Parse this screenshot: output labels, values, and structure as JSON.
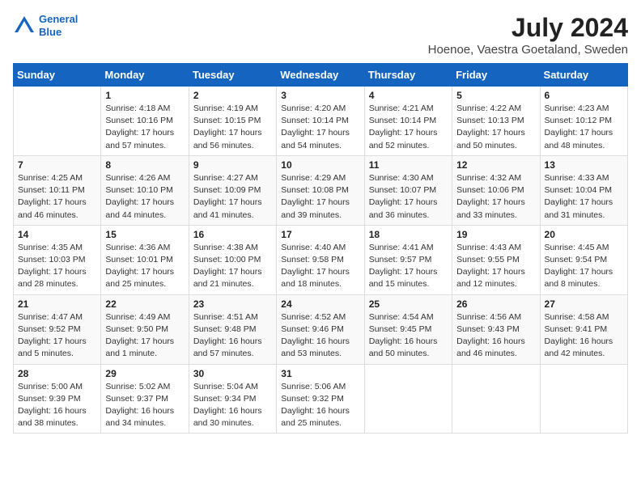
{
  "header": {
    "logo_line1": "General",
    "logo_line2": "Blue",
    "month_year": "July 2024",
    "location": "Hoenoe, Vaestra Goetaland, Sweden"
  },
  "weekdays": [
    "Sunday",
    "Monday",
    "Tuesday",
    "Wednesday",
    "Thursday",
    "Friday",
    "Saturday"
  ],
  "weeks": [
    [
      {
        "day": "",
        "info": ""
      },
      {
        "day": "1",
        "info": "Sunrise: 4:18 AM\nSunset: 10:16 PM\nDaylight: 17 hours\nand 57 minutes."
      },
      {
        "day": "2",
        "info": "Sunrise: 4:19 AM\nSunset: 10:15 PM\nDaylight: 17 hours\nand 56 minutes."
      },
      {
        "day": "3",
        "info": "Sunrise: 4:20 AM\nSunset: 10:14 PM\nDaylight: 17 hours\nand 54 minutes."
      },
      {
        "day": "4",
        "info": "Sunrise: 4:21 AM\nSunset: 10:14 PM\nDaylight: 17 hours\nand 52 minutes."
      },
      {
        "day": "5",
        "info": "Sunrise: 4:22 AM\nSunset: 10:13 PM\nDaylight: 17 hours\nand 50 minutes."
      },
      {
        "day": "6",
        "info": "Sunrise: 4:23 AM\nSunset: 10:12 PM\nDaylight: 17 hours\nand 48 minutes."
      }
    ],
    [
      {
        "day": "7",
        "info": "Sunrise: 4:25 AM\nSunset: 10:11 PM\nDaylight: 17 hours\nand 46 minutes."
      },
      {
        "day": "8",
        "info": "Sunrise: 4:26 AM\nSunset: 10:10 PM\nDaylight: 17 hours\nand 44 minutes."
      },
      {
        "day": "9",
        "info": "Sunrise: 4:27 AM\nSunset: 10:09 PM\nDaylight: 17 hours\nand 41 minutes."
      },
      {
        "day": "10",
        "info": "Sunrise: 4:29 AM\nSunset: 10:08 PM\nDaylight: 17 hours\nand 39 minutes."
      },
      {
        "day": "11",
        "info": "Sunrise: 4:30 AM\nSunset: 10:07 PM\nDaylight: 17 hours\nand 36 minutes."
      },
      {
        "day": "12",
        "info": "Sunrise: 4:32 AM\nSunset: 10:06 PM\nDaylight: 17 hours\nand 33 minutes."
      },
      {
        "day": "13",
        "info": "Sunrise: 4:33 AM\nSunset: 10:04 PM\nDaylight: 17 hours\nand 31 minutes."
      }
    ],
    [
      {
        "day": "14",
        "info": "Sunrise: 4:35 AM\nSunset: 10:03 PM\nDaylight: 17 hours\nand 28 minutes."
      },
      {
        "day": "15",
        "info": "Sunrise: 4:36 AM\nSunset: 10:01 PM\nDaylight: 17 hours\nand 25 minutes."
      },
      {
        "day": "16",
        "info": "Sunrise: 4:38 AM\nSunset: 10:00 PM\nDaylight: 17 hours\nand 21 minutes."
      },
      {
        "day": "17",
        "info": "Sunrise: 4:40 AM\nSunset: 9:58 PM\nDaylight: 17 hours\nand 18 minutes."
      },
      {
        "day": "18",
        "info": "Sunrise: 4:41 AM\nSunset: 9:57 PM\nDaylight: 17 hours\nand 15 minutes."
      },
      {
        "day": "19",
        "info": "Sunrise: 4:43 AM\nSunset: 9:55 PM\nDaylight: 17 hours\nand 12 minutes."
      },
      {
        "day": "20",
        "info": "Sunrise: 4:45 AM\nSunset: 9:54 PM\nDaylight: 17 hours\nand 8 minutes."
      }
    ],
    [
      {
        "day": "21",
        "info": "Sunrise: 4:47 AM\nSunset: 9:52 PM\nDaylight: 17 hours\nand 5 minutes."
      },
      {
        "day": "22",
        "info": "Sunrise: 4:49 AM\nSunset: 9:50 PM\nDaylight: 17 hours\nand 1 minute."
      },
      {
        "day": "23",
        "info": "Sunrise: 4:51 AM\nSunset: 9:48 PM\nDaylight: 16 hours\nand 57 minutes."
      },
      {
        "day": "24",
        "info": "Sunrise: 4:52 AM\nSunset: 9:46 PM\nDaylight: 16 hours\nand 53 minutes."
      },
      {
        "day": "25",
        "info": "Sunrise: 4:54 AM\nSunset: 9:45 PM\nDaylight: 16 hours\nand 50 minutes."
      },
      {
        "day": "26",
        "info": "Sunrise: 4:56 AM\nSunset: 9:43 PM\nDaylight: 16 hours\nand 46 minutes."
      },
      {
        "day": "27",
        "info": "Sunrise: 4:58 AM\nSunset: 9:41 PM\nDaylight: 16 hours\nand 42 minutes."
      }
    ],
    [
      {
        "day": "28",
        "info": "Sunrise: 5:00 AM\nSunset: 9:39 PM\nDaylight: 16 hours\nand 38 minutes."
      },
      {
        "day": "29",
        "info": "Sunrise: 5:02 AM\nSunset: 9:37 PM\nDaylight: 16 hours\nand 34 minutes."
      },
      {
        "day": "30",
        "info": "Sunrise: 5:04 AM\nSunset: 9:34 PM\nDaylight: 16 hours\nand 30 minutes."
      },
      {
        "day": "31",
        "info": "Sunrise: 5:06 AM\nSunset: 9:32 PM\nDaylight: 16 hours\nand 25 minutes."
      },
      {
        "day": "",
        "info": ""
      },
      {
        "day": "",
        "info": ""
      },
      {
        "day": "",
        "info": ""
      }
    ]
  ]
}
